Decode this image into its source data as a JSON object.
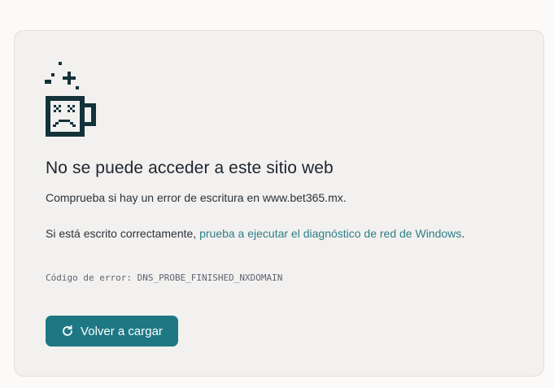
{
  "error_page": {
    "title": "No se puede acceder a este sitio web",
    "line1": "Comprueba si hay un error de escritura en www.bet365.mx.",
    "line2_prefix": "Si está escrito correctamente, ",
    "line2_link": "prueba a ejecutar el diagnóstico de red de Windows",
    "line2_suffix": ".",
    "error_code": "Código de error: DNS_PROBE_FINISHED_NXDOMAIN",
    "reload_label": "Volver a cargar",
    "icons": {
      "illustration": "sad-mug-icon",
      "reload": "refresh-icon"
    }
  },
  "colors": {
    "page_bg": "#fbfaf8",
    "card_bg": "#f2f1ef",
    "text": "#1d2530",
    "link": "#2f7d87",
    "button": "#1d7884",
    "icon": "#13323a"
  }
}
